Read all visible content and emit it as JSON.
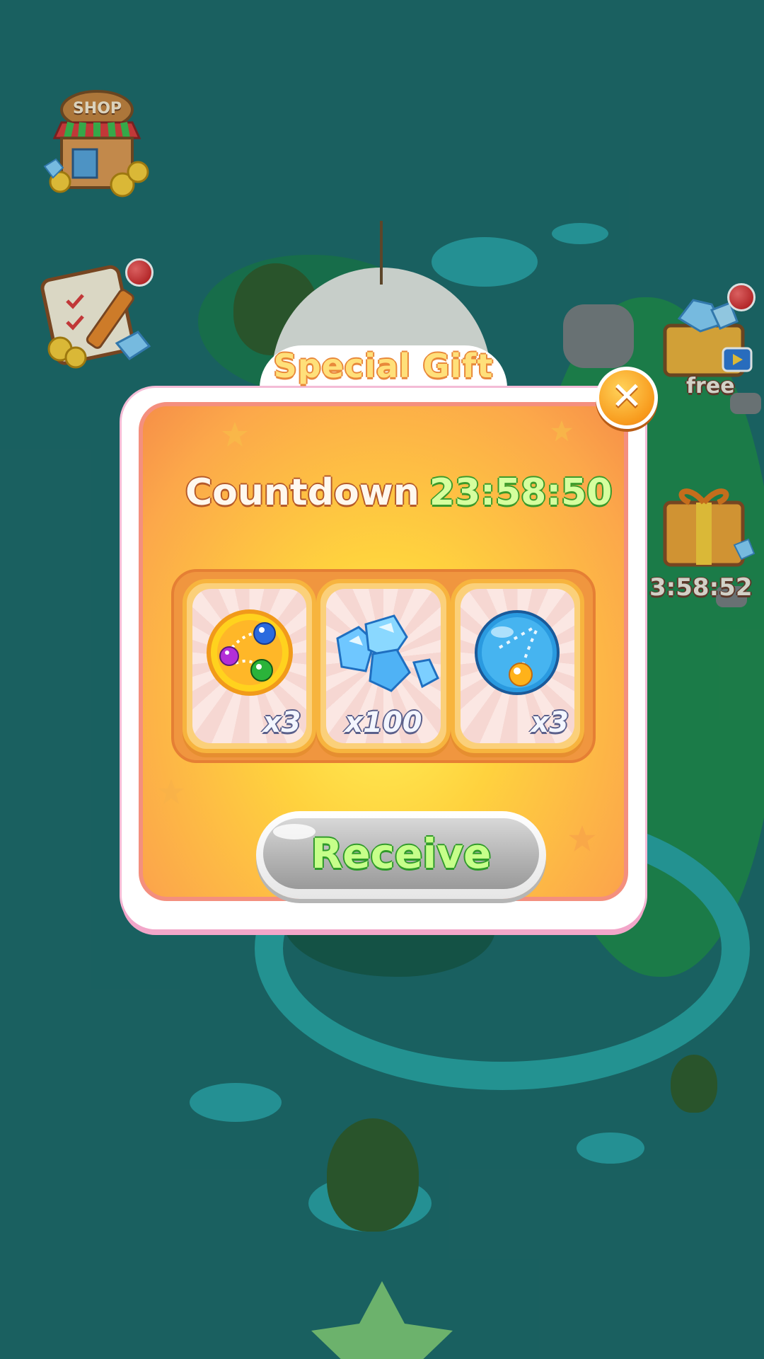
{
  "dialog": {
    "title": "Special Gift",
    "countdown_label": "Countdown",
    "countdown_value": "23:58:50",
    "rewards": [
      {
        "icon": "color-balls-powerup-icon",
        "quantity": "x3"
      },
      {
        "icon": "diamonds-icon",
        "quantity": "x100"
      },
      {
        "icon": "aim-bubble-powerup-icon",
        "quantity": "x3"
      }
    ],
    "receive_label": "Receive",
    "close_icon": "close-icon"
  },
  "side_menu": {
    "shop_label": "SHOP"
  },
  "right_events": {
    "free_chest_label": "free",
    "gift_timer": "3:58:52"
  },
  "colors": {
    "background": "#1d6a6a",
    "dialog_inner": "#ffd23e",
    "accent_green": "#3a9a2a"
  }
}
